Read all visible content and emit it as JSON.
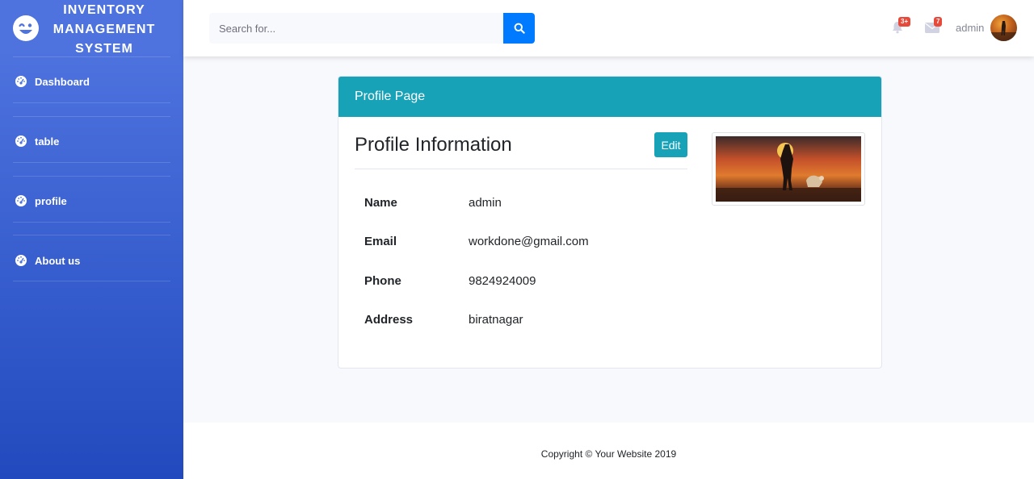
{
  "brand": {
    "line1": "INVENTORY",
    "line2": "MANAGEMENT",
    "line3": "SYSTEM",
    "icon": "laugh-wink-icon"
  },
  "sidebar": {
    "items": [
      {
        "label": "Dashboard",
        "icon": "tachometer-icon"
      },
      {
        "label": "table",
        "icon": "tachometer-icon"
      },
      {
        "label": "profile",
        "icon": "tachometer-icon"
      },
      {
        "label": "About us",
        "icon": "tachometer-icon"
      }
    ]
  },
  "topbar": {
    "search_placeholder": "Search for...",
    "alerts_badge": "3+",
    "messages_badge": "7",
    "user_name": "admin"
  },
  "card": {
    "header": "Profile Page",
    "title": "Profile Information",
    "edit_label": "Edit",
    "fields": [
      {
        "label": "Name",
        "value": "admin"
      },
      {
        "label": "Email",
        "value": "workdone@gmail.com"
      },
      {
        "label": "Phone",
        "value": "9824924009"
      },
      {
        "label": "Address",
        "value": "biratnagar"
      }
    ]
  },
  "footer": {
    "text": "Copyright © Your Website 2019"
  },
  "colors": {
    "sidebar_top": "#4e73df",
    "sidebar_bottom": "#224abe",
    "search_button": "#007bff",
    "card_header": "#17a2b8",
    "badge": "#e74a3b"
  }
}
